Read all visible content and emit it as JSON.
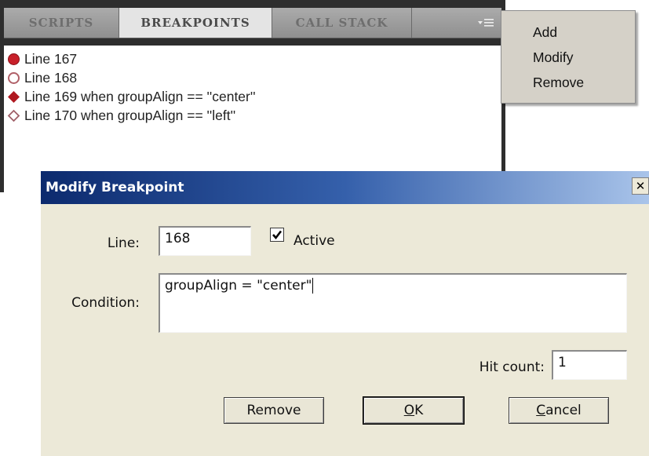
{
  "tabs": [
    {
      "label": "SCRIPTS",
      "active": false
    },
    {
      "label": "BREAKPOINTS",
      "active": true
    },
    {
      "label": "CALL STACK",
      "active": false
    }
  ],
  "tab_menu_icon": "panel-menu-icon",
  "breakpoints": [
    {
      "label": "Line 167",
      "marker": "circle",
      "filled": true,
      "color": "#c8202a"
    },
    {
      "label": "Line 168",
      "marker": "circle",
      "filled": false,
      "color": "#b06068"
    },
    {
      "label": "Line 169 when groupAlign == ''center''",
      "marker": "diamond",
      "filled": true,
      "color": "#b01820"
    },
    {
      "label": "Line 170 when groupAlign == ''left''",
      "marker": "diamond",
      "filled": false,
      "color": "#a06068"
    }
  ],
  "context_menu": [
    "Add",
    "Modify",
    "Remove"
  ],
  "dialog": {
    "title": "Modify Breakpoint",
    "close_glyph": "✕",
    "line_label": "Line:",
    "line_value": "168",
    "active_label": "Active",
    "active_checked": true,
    "condition_label": "Condition:",
    "condition_value": "groupAlign = \"center\"",
    "hit_count_label": "Hit count:",
    "hit_count_value": "1",
    "buttons": {
      "remove": "Remove",
      "ok_mnemonic": "O",
      "ok_rest": "K",
      "cancel_mnemonic": "C",
      "cancel_rest": "ancel"
    }
  }
}
